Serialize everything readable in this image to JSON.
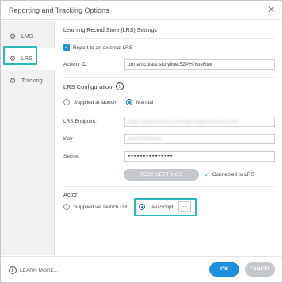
{
  "window": {
    "title": "Reporting and Tracking Options",
    "close_glyph": "✕"
  },
  "sidebar": {
    "items": [
      {
        "label": "LMS",
        "icon": "gear-icon"
      },
      {
        "label": "LRS",
        "icon": "gear-icon"
      },
      {
        "label": "Tracking",
        "icon": "gear-icon"
      }
    ]
  },
  "lrs_settings": {
    "heading": "Learning Record Store (LRS) Settings",
    "report_checkbox_label": "Report to an external LRS",
    "activity_id_label": "Activity ID:",
    "activity_id_value": "urn:articulate:storyline:5ZPHIYueRtw"
  },
  "lrs_config": {
    "heading": "LRS Configuration",
    "supplied_at_launch": "Supplied at launch",
    "manual": "Manual",
    "endpoint_label": "LRS Endpoint:",
    "endpoint_value": "https://watershedlrs.com/api/organizations/11/lrs/",
    "key_label": "Key:",
    "key_value": "6aa61d6ebeab",
    "secret_label": "Secret:",
    "secret_value": "●●●●●●●●●●●●●●●",
    "test_button": "TEST SETTINGS",
    "connected_label": "Connected to LRS"
  },
  "actor": {
    "heading": "Actor",
    "supplied_via_url": "Supplied via launch URL",
    "javascript": "JavaScript",
    "ellipsis": "..."
  },
  "footer": {
    "learn_more": "LEARN MORE...",
    "ok": "OK",
    "cancel": "CANCEL"
  },
  "colors": {
    "accent": "#1e8fe0",
    "highlight": "#2bb8b8",
    "disabled": "#c4c7cb"
  }
}
